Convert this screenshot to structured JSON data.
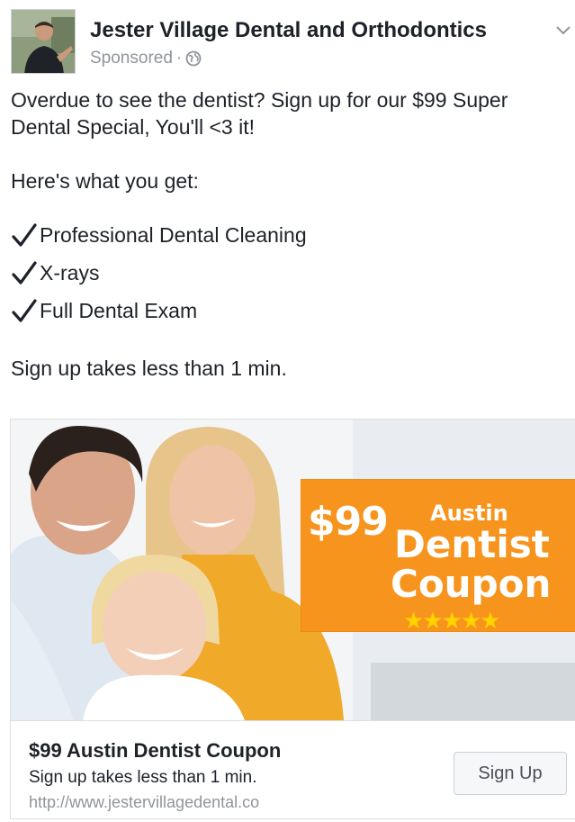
{
  "header": {
    "page_name": "Jester Village Dental and Orthodontics",
    "sponsored": "Sponsored",
    "separator": "·",
    "privacy_icon": "globe-icon",
    "menu_icon": "chevron-down-icon"
  },
  "post": {
    "line1": "Overdue to see the dentist? Sign up for our $99 Super",
    "line2": "Dental Special, You'll  <3 it!",
    "intro": "Here's what you get:",
    "benefits": [
      {
        "icon": "checkmark-icon",
        "label": "Professional Dental Cleaning"
      },
      {
        "icon": "checkmark-icon",
        "label": "X-rays"
      },
      {
        "icon": "checkmark-icon",
        "label": "Full Dental Exam"
      }
    ],
    "closing": "Sign up takes less than 1 min."
  },
  "card": {
    "banner": {
      "price": "$99",
      "austin": "Austin",
      "dentist": "Dentist",
      "coupon": "Coupon",
      "stars": "★★★★★"
    },
    "title": "$99 Austin Dentist Coupon",
    "description": "Sign up takes less than 1 min.",
    "url": "http://www.jestervillagedental.co",
    "cta_label": "Sign Up"
  },
  "colors": {
    "banner_orange": "#f7941d",
    "star_yellow": "#ffd200",
    "muted_text": "#90949c",
    "text": "#1d2129"
  }
}
